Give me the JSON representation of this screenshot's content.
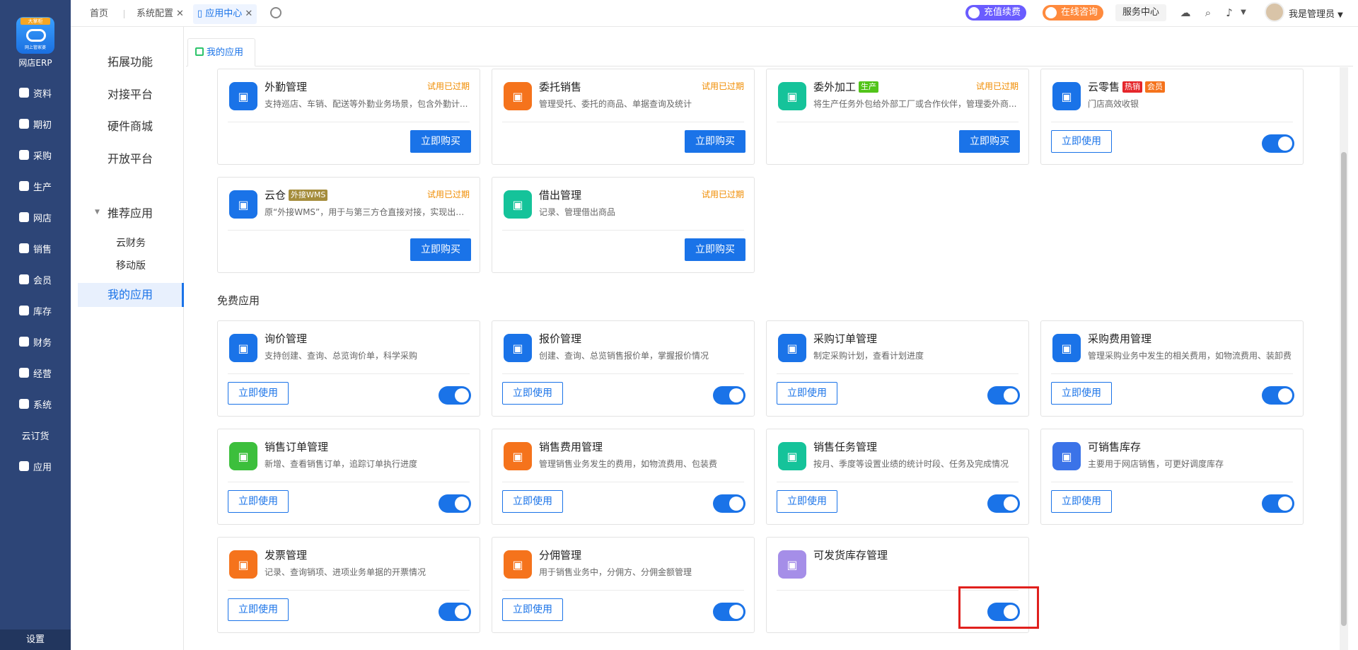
{
  "sidebar": {
    "logo_badge": "大掌柜",
    "logo_mini": "网上管家婆",
    "logo_text": "网店ERP",
    "items": [
      {
        "label": "资料",
        "icon": "doc-icon"
      },
      {
        "label": "期初",
        "icon": "clock-icon"
      },
      {
        "label": "采购",
        "icon": "cart-icon"
      },
      {
        "label": "生产",
        "icon": "factory-icon"
      },
      {
        "label": "网店",
        "icon": "store-icon"
      },
      {
        "label": "销售",
        "icon": "chart-icon"
      },
      {
        "label": "会员",
        "icon": "pie-icon"
      },
      {
        "label": "库存",
        "icon": "warehouse-icon"
      },
      {
        "label": "财务",
        "icon": "money-icon"
      },
      {
        "label": "经营",
        "icon": "trend-icon"
      },
      {
        "label": "系统",
        "icon": "gear-icon"
      },
      {
        "label": "云订货",
        "icon": ""
      },
      {
        "label": "应用",
        "icon": "plus-icon"
      }
    ],
    "settings": "设置"
  },
  "topbar": {
    "tabs": [
      {
        "label": "首页"
      },
      {
        "label": "系统配置"
      },
      {
        "label": "应用中心"
      }
    ],
    "recharge": "充值续费",
    "consult": "在线咨询",
    "service": "服务中心",
    "user": "我是管理员"
  },
  "subnav": {
    "items": [
      "拓展功能",
      "对接平台",
      "硬件商城",
      "开放平台"
    ],
    "recommend": "推荐应用",
    "recommend_children": [
      "云财务",
      "移动版"
    ],
    "my_apps": "我的应用"
  },
  "content_tab": "我的应用",
  "free_title": "免费应用",
  "buttons": {
    "buy": "立即购买",
    "use": "立即使用"
  },
  "paid_apps": [
    {
      "name": "外勤管理",
      "tags": [],
      "desc": "支持巡店、车销、配送等外勤业务场景，包含外勤计...",
      "status": "试用已过期",
      "action": "buy",
      "color": "#1a73e8"
    },
    {
      "name": "委托销售",
      "tags": [],
      "desc": "管理受托、委托的商品、单据查询及统计",
      "status": "试用已过期",
      "action": "buy",
      "color": "#f5731c"
    },
    {
      "name": "委外加工",
      "tags": [
        {
          "text": "生产",
          "color": "#52c41a"
        }
      ],
      "desc": "将生产任务外包给外部工厂或合作伙伴，管理委外商...",
      "status": "试用已过期",
      "action": "buy",
      "color": "#15c39a"
    },
    {
      "name": "云零售",
      "tags": [
        {
          "text": "热销",
          "color": "#e5262b"
        },
        {
          "text": "会员",
          "color": "#f5731c"
        }
      ],
      "desc": "门店高效收银",
      "status": "",
      "action": "use",
      "toggle": true,
      "color": "#1a73e8"
    },
    {
      "name": "云仓",
      "tags": [
        {
          "text": "外接WMS",
          "color": "#a58d3c"
        }
      ],
      "desc": "原“外接WMS”，用于与第三方仓直接对接，实现出入...",
      "status": "试用已过期",
      "action": "buy",
      "color": "#1a73e8"
    },
    {
      "name": "借出管理",
      "tags": [],
      "desc": "记录、管理借出商品",
      "status": "试用已过期",
      "action": "buy",
      "color": "#15c39a"
    }
  ],
  "free_apps": [
    {
      "name": "询价管理",
      "desc": "支持创建、查询、总览询价单，科学采购",
      "color": "#1a73e8",
      "button": true
    },
    {
      "name": "报价管理",
      "desc": "创建、查询、总览销售报价单，掌握报价情况",
      "color": "#1a73e8",
      "button": true
    },
    {
      "name": "采购订单管理",
      "desc": "制定采购计划，查看计划进度",
      "color": "#1a73e8",
      "button": true
    },
    {
      "name": "采购费用管理",
      "desc": "管理采购业务中发生的相关费用，如物流费用、装卸费",
      "color": "#1a73e8",
      "button": true
    },
    {
      "name": "销售订单管理",
      "desc": "新增、查看销售订单，追踪订单执行进度",
      "color": "#3cbf3c",
      "button": true
    },
    {
      "name": "销售费用管理",
      "desc": "管理销售业务发生的费用，如物流费用、包装费",
      "color": "#f5731c",
      "button": true
    },
    {
      "name": "销售任务管理",
      "desc": "按月、季度等设置业绩的统计时段、任务及完成情况",
      "color": "#15c39a",
      "button": true
    },
    {
      "name": "可销售库存",
      "desc": "主要用于网店销售，可更好调度库存",
      "color": "#3b73e8",
      "button": true
    },
    {
      "name": "发票管理",
      "desc": "记录、查询销项、进项业务单据的开票情况",
      "color": "#f5731c",
      "button": true
    },
    {
      "name": "分佣管理",
      "desc": "用于销售业务中，分佣方、分佣金额管理",
      "color": "#f5731c",
      "button": true
    },
    {
      "name": "可发货库存管理",
      "desc": "",
      "color": "#a58ee8",
      "button": false
    }
  ]
}
